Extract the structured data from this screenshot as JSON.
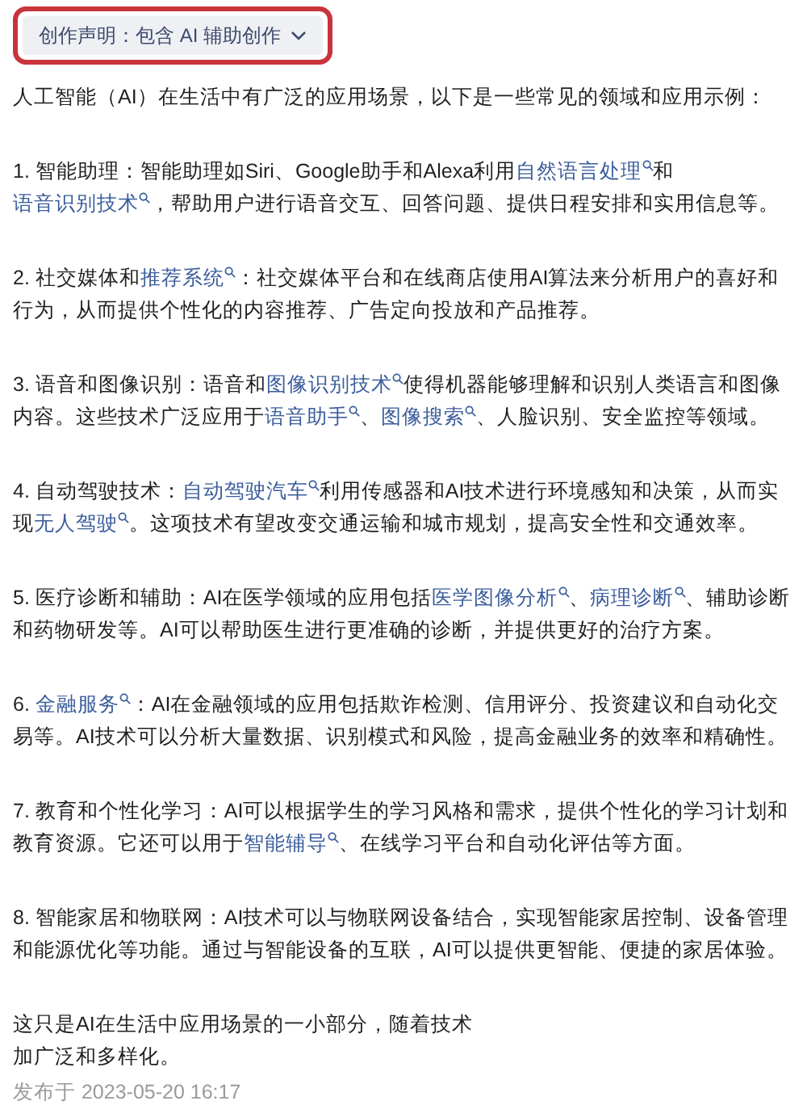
{
  "declaration": {
    "label": "创作声明：包含 AI 辅助创作",
    "highlighted": true
  },
  "intro": "人工智能（AI）在生活中有广泛的应用场景，以下是一些常见的领域和应用示例：",
  "items": [
    {
      "segments": [
        {
          "kind": "text",
          "text": "1. 智能助理：智能助理如Siri、Google助手和Alexa利用"
        },
        {
          "kind": "link",
          "text": "自然语言处理"
        },
        {
          "kind": "text",
          "text": "和"
        },
        {
          "kind": "link",
          "text": "语音识别技术"
        },
        {
          "kind": "text",
          "text": "，帮助用户进行语音交互、回答问题、提供日程安排和实用信息等。"
        }
      ]
    },
    {
      "segments": [
        {
          "kind": "text",
          "text": "2. 社交媒体和"
        },
        {
          "kind": "link",
          "text": "推荐系统"
        },
        {
          "kind": "text",
          "text": "：社交媒体平台和在线商店使用AI算法来分析用户的喜好和行为，从而提供个性化的内容推荐、广告定向投放和产品推荐。"
        }
      ]
    },
    {
      "segments": [
        {
          "kind": "text",
          "text": "3. 语音和图像识别：语音和"
        },
        {
          "kind": "link",
          "text": "图像识别技术"
        },
        {
          "kind": "text",
          "text": "使得机器能够理解和识别人类语言和图像内容。这些技术广泛应用于"
        },
        {
          "kind": "link",
          "text": "语音助手"
        },
        {
          "kind": "text",
          "text": "、"
        },
        {
          "kind": "link",
          "text": "图像搜索"
        },
        {
          "kind": "text",
          "text": "、人脸识别、安全监控等领域。"
        }
      ]
    },
    {
      "segments": [
        {
          "kind": "text",
          "text": "4. 自动驾驶技术："
        },
        {
          "kind": "link",
          "text": "自动驾驶汽车"
        },
        {
          "kind": "text",
          "text": "利用传感器和AI技术进行环境感知和决策，从而实现"
        },
        {
          "kind": "link",
          "text": "无人驾驶"
        },
        {
          "kind": "text",
          "text": "。这项技术有望改变交通运输和城市规划，提高安全性和交通效率。"
        }
      ]
    },
    {
      "segments": [
        {
          "kind": "text",
          "text": "5. 医疗诊断和辅助：AI在医学领域的应用包括"
        },
        {
          "kind": "link",
          "text": "医学图像分析"
        },
        {
          "kind": "text",
          "text": "、"
        },
        {
          "kind": "link",
          "text": "病理诊断"
        },
        {
          "kind": "text",
          "text": "、辅助诊断和药物研发等。AI可以帮助医生进行更准确的诊断，并提供更好的治疗方案。"
        }
      ]
    },
    {
      "segments": [
        {
          "kind": "text",
          "text": "6. "
        },
        {
          "kind": "link",
          "text": "金融服务"
        },
        {
          "kind": "text",
          "text": "：AI在金融领域的应用包括欺诈检测、信用评分、投资建议和自动化交易等。AI技术可以分析大量数据、识别模式和风险，提高金融业务的效率和精确性。"
        }
      ]
    },
    {
      "segments": [
        {
          "kind": "text",
          "text": "7. 教育和个性化学习：AI可以根据学生的学习风格和需求，提供个性化的学习计划和教育资源。它还可以用于"
        },
        {
          "kind": "link",
          "text": "智能辅导"
        },
        {
          "kind": "text",
          "text": "、在线学习平台和自动化评估等方面。"
        }
      ]
    },
    {
      "segments": [
        {
          "kind": "text",
          "text": "8. 智能家居和物联网：AI技术可以与物联网设备结合，实现智能家居控制、设备管理和能源优化等功能。通过与智能设备的互联，AI可以提供更智能、便捷的家居体验。"
        }
      ]
    }
  ],
  "closing": [
    "这只是AI在生活中应用场景的一小部分，随着技术",
    "加广泛和多样化。"
  ],
  "published": "发布于 2023-05-20 16:17"
}
